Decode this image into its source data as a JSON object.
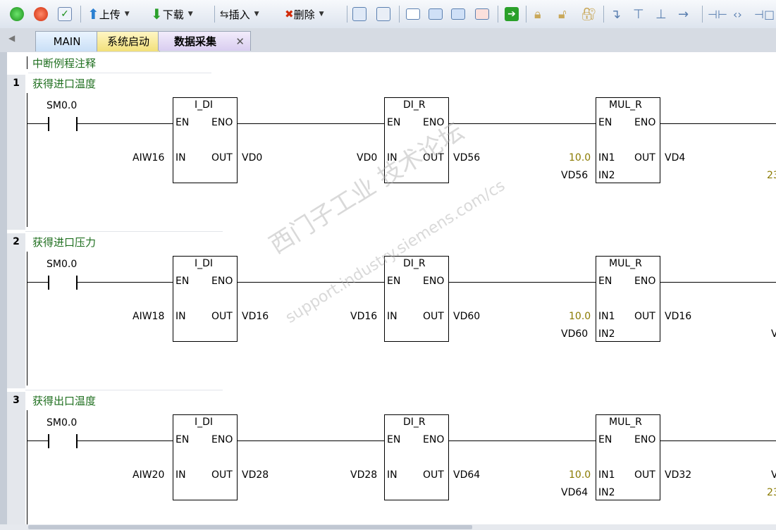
{
  "toolbar": {
    "upload_label": "上传",
    "download_label": "下载",
    "insert_label": "插入",
    "delete_label": "删除"
  },
  "tabs": [
    {
      "label": "MAIN"
    },
    {
      "label": "系统启动"
    },
    {
      "label": "数据采集"
    }
  ],
  "tab_close_glyph": "✕",
  "routine_comment": "中断例程注释",
  "networks": [
    {
      "number": "1",
      "comment": "获得进口温度",
      "contact": "SM0.0",
      "block1": {
        "name": "I_DI",
        "in": "AIW16",
        "out": "VD0"
      },
      "block2": {
        "name": "DI_R",
        "in": "VD0",
        "out": "VD56"
      },
      "block3": {
        "name": "MUL_R",
        "in1": "10.0",
        "in2": "VD56",
        "out": "VD4"
      },
      "right_partial": "23"
    },
    {
      "number": "2",
      "comment": "获得进口压力",
      "contact": "SM0.0",
      "block1": {
        "name": "I_DI",
        "in": "AIW18",
        "out": "VD16"
      },
      "block2": {
        "name": "DI_R",
        "in": "VD16",
        "out": "VD60"
      },
      "block3": {
        "name": "MUL_R",
        "in1": "10.0",
        "in2": "VD60",
        "out": "VD16"
      },
      "right_partial": "V"
    },
    {
      "number": "3",
      "comment": "获得出口温度",
      "contact": "SM0.0",
      "block1": {
        "name": "I_DI",
        "in": "AIW20",
        "out": "VD28"
      },
      "block2": {
        "name": "DI_R",
        "in": "VD28",
        "out": "VD64"
      },
      "block3": {
        "name": "MUL_R",
        "in1": "10.0",
        "in2": "VD64",
        "out": "VD32"
      },
      "right_partial": "V",
      "right_partial2": "23"
    }
  ],
  "pins": {
    "en": "EN",
    "eno": "ENO",
    "in": "IN",
    "out": "OUT",
    "in1": "IN1",
    "in2": "IN2"
  },
  "watermark": {
    "line1": "西门子工业 技术论坛",
    "line2": "support.industry.siemens.com/cs"
  }
}
